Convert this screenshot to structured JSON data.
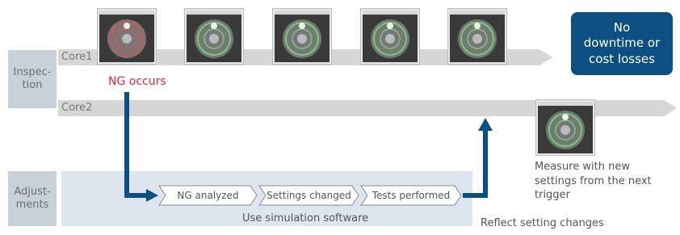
{
  "lanes": {
    "inspection_label": "Inspec-\ntion",
    "adjustments_label": "Adjust-\nments"
  },
  "cores": {
    "core1": "Core1",
    "core2": "Core2"
  },
  "ng_occurs": "NG occurs",
  "status_box": "No\ndowntime or\ncost losses",
  "steps": [
    "NG analyzed",
    "Settings changed",
    "Tests performed"
  ],
  "simulation_caption": "Use simulation software",
  "reflect_caption": "Reflect setting changes",
  "measure_caption": "Measure with new\nsettings from the next\ntrigger",
  "thumbnails": [
    {
      "state": "NG",
      "ring_color": "#d9534f"
    },
    {
      "state": "OK",
      "ring_color": "#6fcf6f"
    },
    {
      "state": "OK",
      "ring_color": "#6fcf6f"
    },
    {
      "state": "OK",
      "ring_color": "#6fcf6f"
    },
    {
      "state": "OK",
      "ring_color": "#6fcf6f"
    },
    {
      "state": "OK",
      "ring_color": "#6fcf6f"
    }
  ],
  "colors": {
    "lane_bar": "#c9d1d8",
    "arrow_bar": "#d6d6d6",
    "flow_arrow": "#0c4f82",
    "adjust_panel": "#dde5ef",
    "ng_text": "#e0262f"
  }
}
